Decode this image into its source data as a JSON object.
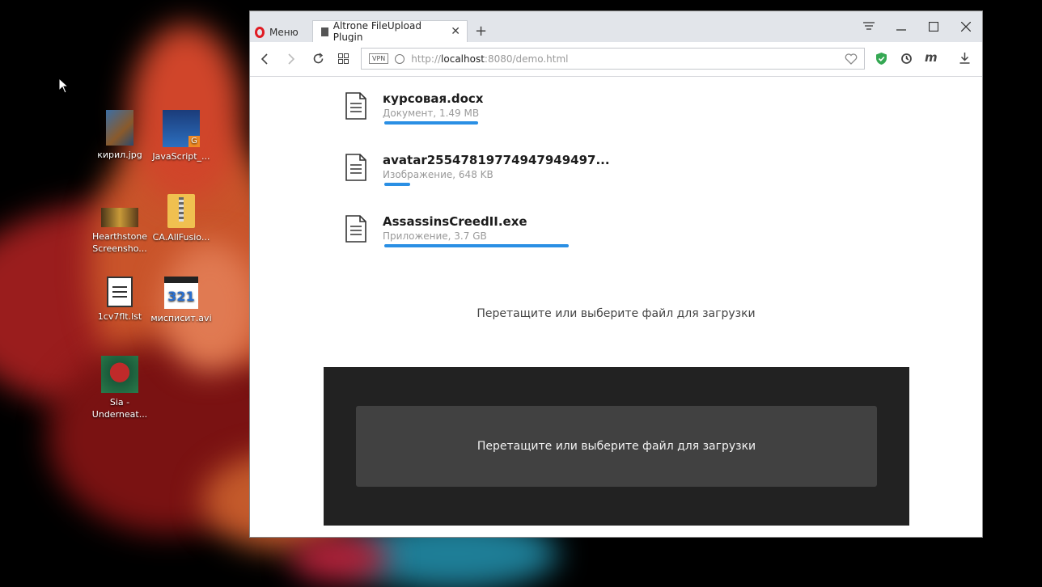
{
  "desktop": {
    "icons": [
      {
        "label": "кирил.jpg"
      },
      {
        "label": "JavaScript_..."
      },
      {
        "label": "Hearthstone Screensho..."
      },
      {
        "label": "CA.AllFusio..."
      },
      {
        "label": "1cv7flt.lst"
      },
      {
        "label": "мисписит.avi"
      },
      {
        "label": "Sia - Underneat..."
      }
    ],
    "javascript_badge": "G",
    "avi_badge": "321"
  },
  "browser": {
    "menu_label": "Меню",
    "tab_title": "Altrone FileUpload Plugin",
    "tab_close": "✕",
    "new_tab": "+",
    "vpn_label": "VPN",
    "url": {
      "prefix": "http://",
      "host": "localhost",
      "rest": ":8080/demo.html"
    },
    "ext_m": "m"
  },
  "page": {
    "files": [
      {
        "name": "курсовая.docx",
        "meta": "Документ, 1.49 MB",
        "progress": 0.51
      },
      {
        "name": "avatar25547819774947949497...",
        "meta": "Изображение, 648 KB",
        "progress": 0.14
      },
      {
        "name": "AssassinsCreedII.exe",
        "meta": "Приложение, 3.7 GB",
        "progress": 1.0
      }
    ],
    "hint_light": "Перетащите или выберите файл для загрузки",
    "hint_dark": "Перетащите или выберите файл для загрузки"
  },
  "colors": {
    "progress": "#2a8fe4",
    "dark_panel": "#222222",
    "dark_inner": "#414141",
    "opera_red": "#e01b23"
  }
}
